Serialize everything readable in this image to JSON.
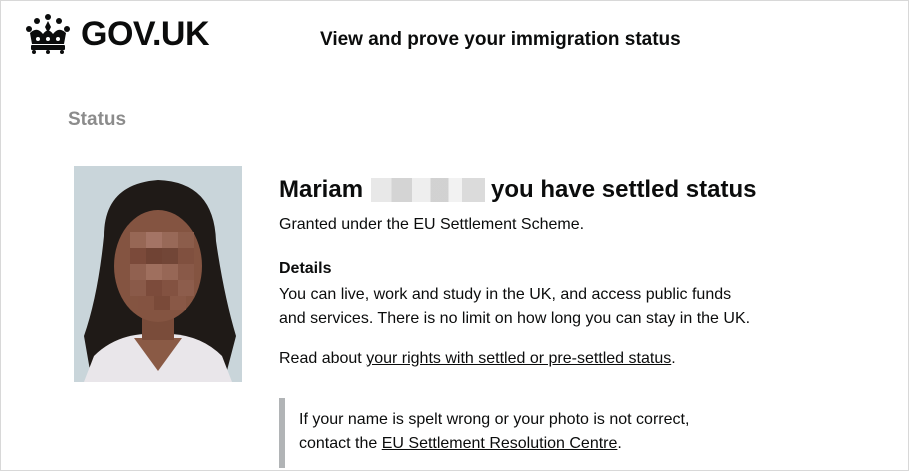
{
  "header": {
    "brand": "GOV.UK",
    "logo_icon": "crown-icon",
    "service_name": "View and prove your immigration status"
  },
  "section_caption": "Status",
  "profile": {
    "photo_icon": "profile-photo",
    "first_name": "Mariam",
    "title_suffix": "you have settled status",
    "granted_text": "Granted under the EU Settlement Scheme."
  },
  "details": {
    "heading": "Details",
    "line1": "You can live, work and study in the UK, and access public funds",
    "line2": "and services. There is no limit on how long you can stay in the UK.",
    "read_about_prefix": "Read about ",
    "rights_link": "your rights with settled or pre-settled status",
    "read_about_suffix": "."
  },
  "inset": {
    "line1": "If your name is spelt wrong or your photo is not correct,",
    "line2_prefix": "contact the ",
    "resolution_link": "EU Settlement Resolution Centre",
    "line2_suffix": "."
  },
  "colors": {
    "text": "#0b0c0c",
    "caption": "#8c8c8c",
    "inset_border": "#b1b4b6"
  }
}
